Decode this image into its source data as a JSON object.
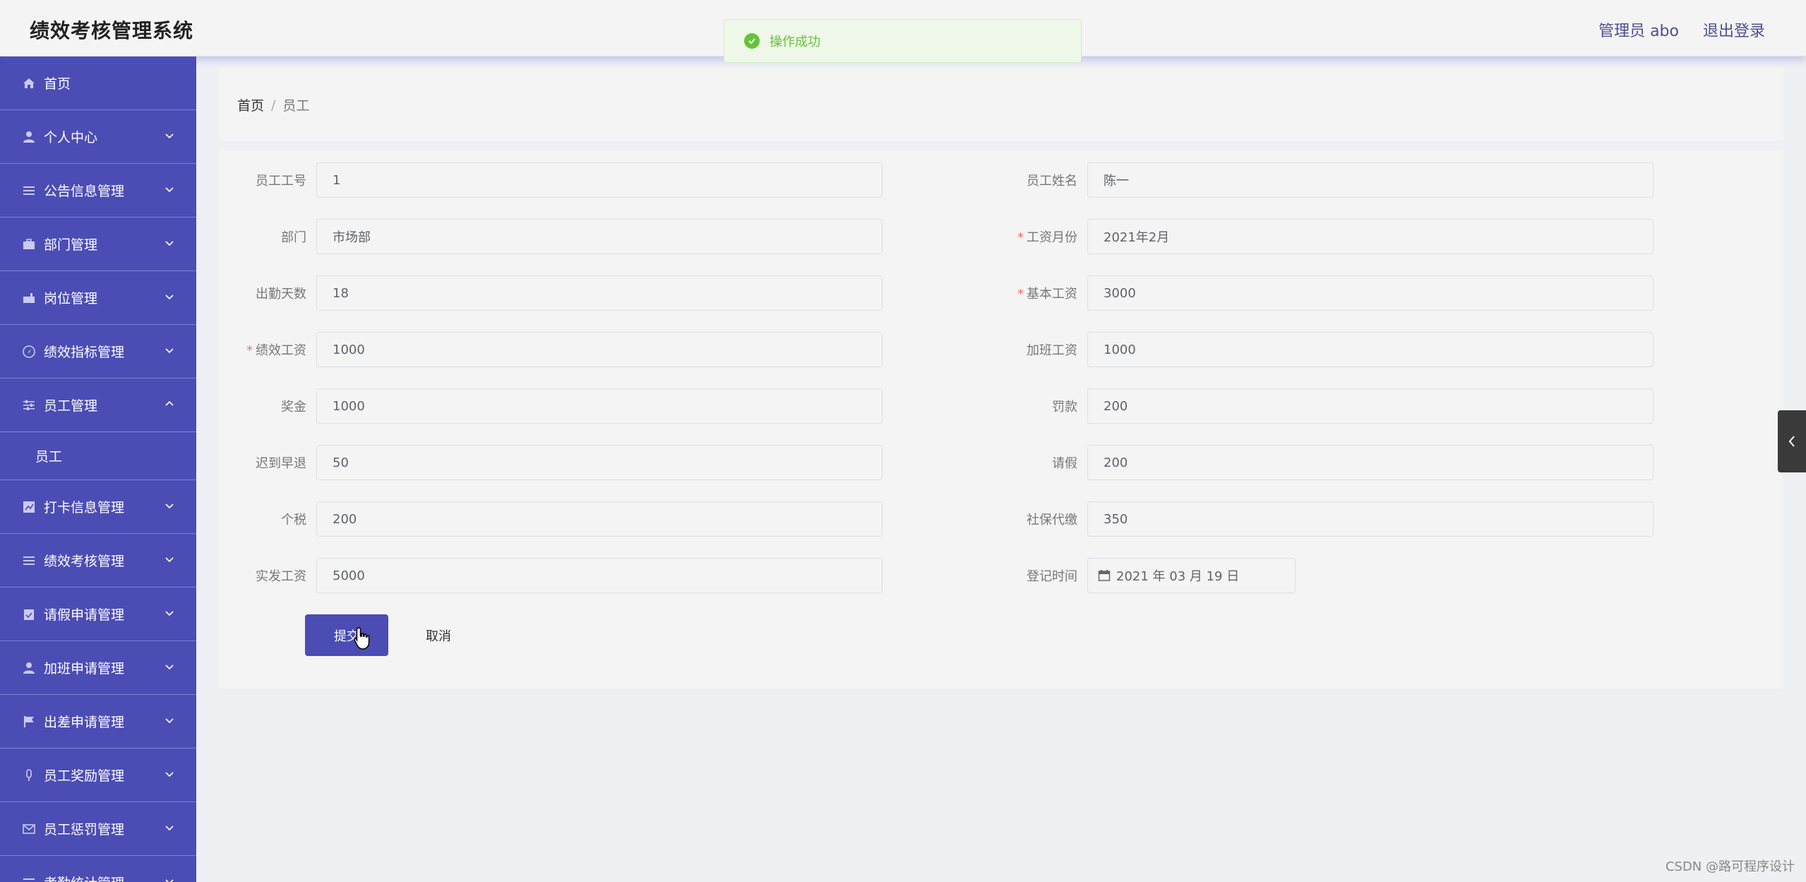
{
  "app": {
    "title": "绩效考核管理系统"
  },
  "header": {
    "user": "管理员 abo",
    "logout": "退出登录"
  },
  "toast": {
    "message": "操作成功",
    "color": "#67c23a"
  },
  "sidebar": {
    "bg": "#4b4db4",
    "items": [
      {
        "label": "首页",
        "icon": "home-icon"
      },
      {
        "label": "个人中心",
        "icon": "user-icon"
      },
      {
        "label": "公告信息管理",
        "icon": "list-icon"
      },
      {
        "label": "部门管理",
        "icon": "briefcase-icon"
      },
      {
        "label": "岗位管理",
        "icon": "post-icon"
      },
      {
        "label": "绩效指标管理",
        "icon": "compass-icon"
      },
      {
        "label": "员工管理",
        "icon": "sliders-icon",
        "expanded": true,
        "children": [
          {
            "label": "员工"
          }
        ]
      },
      {
        "label": "打卡信息管理",
        "icon": "chart-icon"
      },
      {
        "label": "绩效考核管理",
        "icon": "list-icon"
      },
      {
        "label": "请假申请管理",
        "icon": "clipboard-icon"
      },
      {
        "label": "加班申请管理",
        "icon": "user-icon"
      },
      {
        "label": "出差申请管理",
        "icon": "flag-icon"
      },
      {
        "label": "员工奖励管理",
        "icon": "mic-icon"
      },
      {
        "label": "员工惩罚管理",
        "icon": "mail-icon"
      },
      {
        "label": "考勤统计管理",
        "icon": "list-icon"
      }
    ]
  },
  "breadcrumb": {
    "home": "首页",
    "sep": "/",
    "current": "员工"
  },
  "form": {
    "left": [
      {
        "label": "员工工号",
        "value": "1",
        "required": false
      },
      {
        "label": "部门",
        "value": "市场部",
        "required": false
      },
      {
        "label": "出勤天数",
        "value": "18",
        "required": false
      },
      {
        "label": "绩效工资",
        "value": "1000",
        "required": true
      },
      {
        "label": "奖金",
        "value": "1000",
        "required": false
      },
      {
        "label": "迟到早退",
        "value": "50",
        "required": false
      },
      {
        "label": "个税",
        "value": "200",
        "required": false
      },
      {
        "label": "实发工资",
        "value": "5000",
        "required": false
      }
    ],
    "right": [
      {
        "label": "员工姓名",
        "value": "陈一",
        "required": false
      },
      {
        "label": "工资月份",
        "value": "2021年2月",
        "required": true
      },
      {
        "label": "基本工资",
        "value": "3000",
        "required": true
      },
      {
        "label": "加班工资",
        "value": "1000",
        "required": false
      },
      {
        "label": "罚款",
        "value": "200",
        "required": false
      },
      {
        "label": "请假",
        "value": "200",
        "required": false
      },
      {
        "label": "社保代缴",
        "value": "350",
        "required": false
      },
      {
        "label": "登记时间",
        "value": "2021 年 03 月 19 日",
        "required": false,
        "type": "date"
      }
    ],
    "submit": "提交",
    "cancel": "取消"
  },
  "watermark": "CSDN @路可程序设计"
}
